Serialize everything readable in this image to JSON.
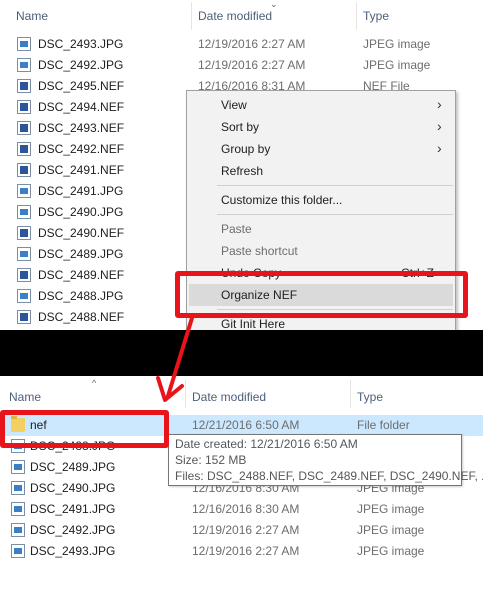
{
  "top_pane": {
    "headers": {
      "name": "Name",
      "date": "Date modified",
      "type": "Type"
    },
    "rows": [
      {
        "name": "DSC_2493.JPG",
        "date": "12/19/2016 2:27 AM",
        "type": "JPEG image",
        "icon": "jpg-file-icon"
      },
      {
        "name": "DSC_2492.JPG",
        "date": "12/19/2016 2:27 AM",
        "type": "JPEG image",
        "icon": "jpg-file-icon"
      },
      {
        "name": "DSC_2495.NEF",
        "date": "12/16/2016 8:31 AM",
        "type": "NEF File",
        "icon": "nef-file-icon"
      },
      {
        "name": "DSC_2494.NEF",
        "date": "",
        "type": "",
        "icon": "nef-file-icon"
      },
      {
        "name": "DSC_2493.NEF",
        "date": "",
        "type": "",
        "icon": "nef-file-icon"
      },
      {
        "name": "DSC_2492.NEF",
        "date": "",
        "type": "",
        "icon": "nef-file-icon"
      },
      {
        "name": "DSC_2491.NEF",
        "date": "",
        "type": "",
        "icon": "nef-file-icon"
      },
      {
        "name": "DSC_2491.JPG",
        "date": "",
        "type": "",
        "icon": "jpg-file-icon"
      },
      {
        "name": "DSC_2490.JPG",
        "date": "",
        "type": "",
        "icon": "jpg-file-icon"
      },
      {
        "name": "DSC_2490.NEF",
        "date": "",
        "type": "",
        "icon": "nef-file-icon"
      },
      {
        "name": "DSC_2489.JPG",
        "date": "",
        "type": "",
        "icon": "jpg-file-icon"
      },
      {
        "name": "DSC_2489.NEF",
        "date": "",
        "type": "",
        "icon": "nef-file-icon"
      },
      {
        "name": "DSC_2488.JPG",
        "date": "",
        "type": "",
        "icon": "jpg-file-icon"
      },
      {
        "name": "DSC_2488.NEF",
        "date": "",
        "type": "",
        "icon": "nef-file-icon"
      }
    ]
  },
  "context_menu": {
    "view": "View",
    "sort_by": "Sort by",
    "group_by": "Group by",
    "refresh": "Refresh",
    "customize": "Customize this folder...",
    "paste": "Paste",
    "paste_shortcut": "Paste shortcut",
    "undo_copy": "Undo Copy",
    "undo_shortcut": "Ctrl+Z",
    "organize_nef": "Organize NEF",
    "git_init": "Git Init Here"
  },
  "bottom_pane": {
    "headers": {
      "name": "Name",
      "date": "Date modified",
      "type": "Type"
    },
    "rows": [
      {
        "name": "nef",
        "date": "12/21/2016 6:50 AM",
        "type": "File folder",
        "icon": "folder-icon",
        "selected": true
      },
      {
        "name": "DSC_2488.JPG",
        "date": "",
        "type": "",
        "icon": "jpg-file-icon"
      },
      {
        "name": "DSC_2489.JPG",
        "date": "",
        "type": "",
        "icon": "jpg-file-icon"
      },
      {
        "name": "DSC_2490.JPG",
        "date": "12/16/2016 8:30 AM",
        "type": "JPEG image",
        "icon": "jpg-file-icon"
      },
      {
        "name": "DSC_2491.JPG",
        "date": "12/16/2016 8:30 AM",
        "type": "JPEG image",
        "icon": "jpg-file-icon"
      },
      {
        "name": "DSC_2492.JPG",
        "date": "12/19/2016 2:27 AM",
        "type": "JPEG image",
        "icon": "jpg-file-icon"
      },
      {
        "name": "DSC_2493.JPG",
        "date": "12/19/2016 2:27 AM",
        "type": "JPEG image",
        "icon": "jpg-file-icon"
      }
    ]
  },
  "tooltip": {
    "created": "Date created: 12/21/2016 6:50 AM",
    "size": "Size: 152 MB",
    "files": "Files: DSC_2488.NEF, DSC_2489.NEF, DSC_2490.NEF, ..."
  },
  "colors": {
    "annotation": "#e8141a",
    "selection": "#cce8ff",
    "menu_bg": "#f2f2f2"
  }
}
